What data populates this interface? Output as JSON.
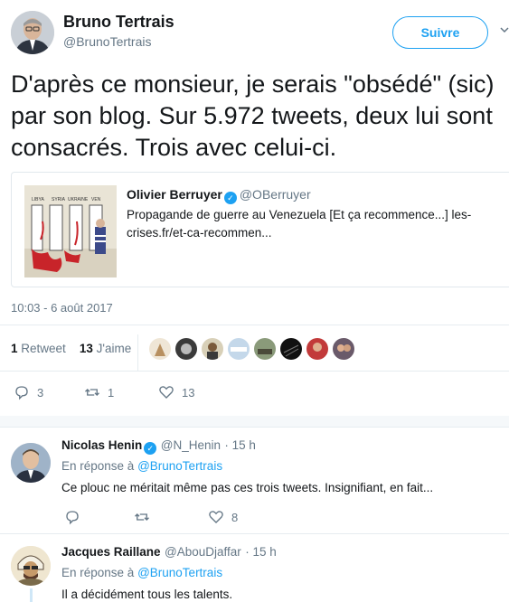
{
  "tweet": {
    "author_name": "Bruno Tertrais",
    "author_handle": "@BrunoTertrais",
    "follow_label": "Suivre",
    "text": "D'après ce monsieur, je serais \"obsédé\" (sic) par son blog. Sur 5.972 tweets, deux lui sont consacrés. Trois avec celui-ci.",
    "timestamp": "10:03 - 6 août 2017",
    "retweet_count": "1",
    "retweet_label": "Retweet",
    "like_count": "13",
    "like_label": "J'aime",
    "actions": {
      "reply_count": "3",
      "retweet_count": "1",
      "like_count": "13"
    }
  },
  "quoted": {
    "name": "Olivier Berruyer",
    "handle": "@OBerruyer",
    "text": "Propagande de guerre au Venezuela [Et ça recommence...]  les-crises.fr/et-ca-recommen...",
    "image_labels": [
      "LIBYA",
      "SYRIA",
      "UKRAINE",
      "VEN"
    ]
  },
  "replies": [
    {
      "name": "Nicolas Henin",
      "verified": true,
      "handle": "@N_Henin",
      "time": "· 15 h",
      "context_prefix": "En réponse à",
      "context_user": "@BrunoTertrais",
      "text": "Ce plouc ne méritait même pas ces trois tweets. Insignifiant, en fait...",
      "like_count": "8"
    },
    {
      "name": "Jacques Raillane",
      "verified": false,
      "handle": "@AbouDjaffar",
      "time": "· 15 h",
      "context_prefix": "En réponse à",
      "context_user": "@BrunoTertrais",
      "text": "Il a décidément tous les talents."
    }
  ],
  "colors": {
    "accent": "#1da1f2",
    "muted": "#657786",
    "text": "#14171a",
    "border": "#e6ecf0"
  }
}
